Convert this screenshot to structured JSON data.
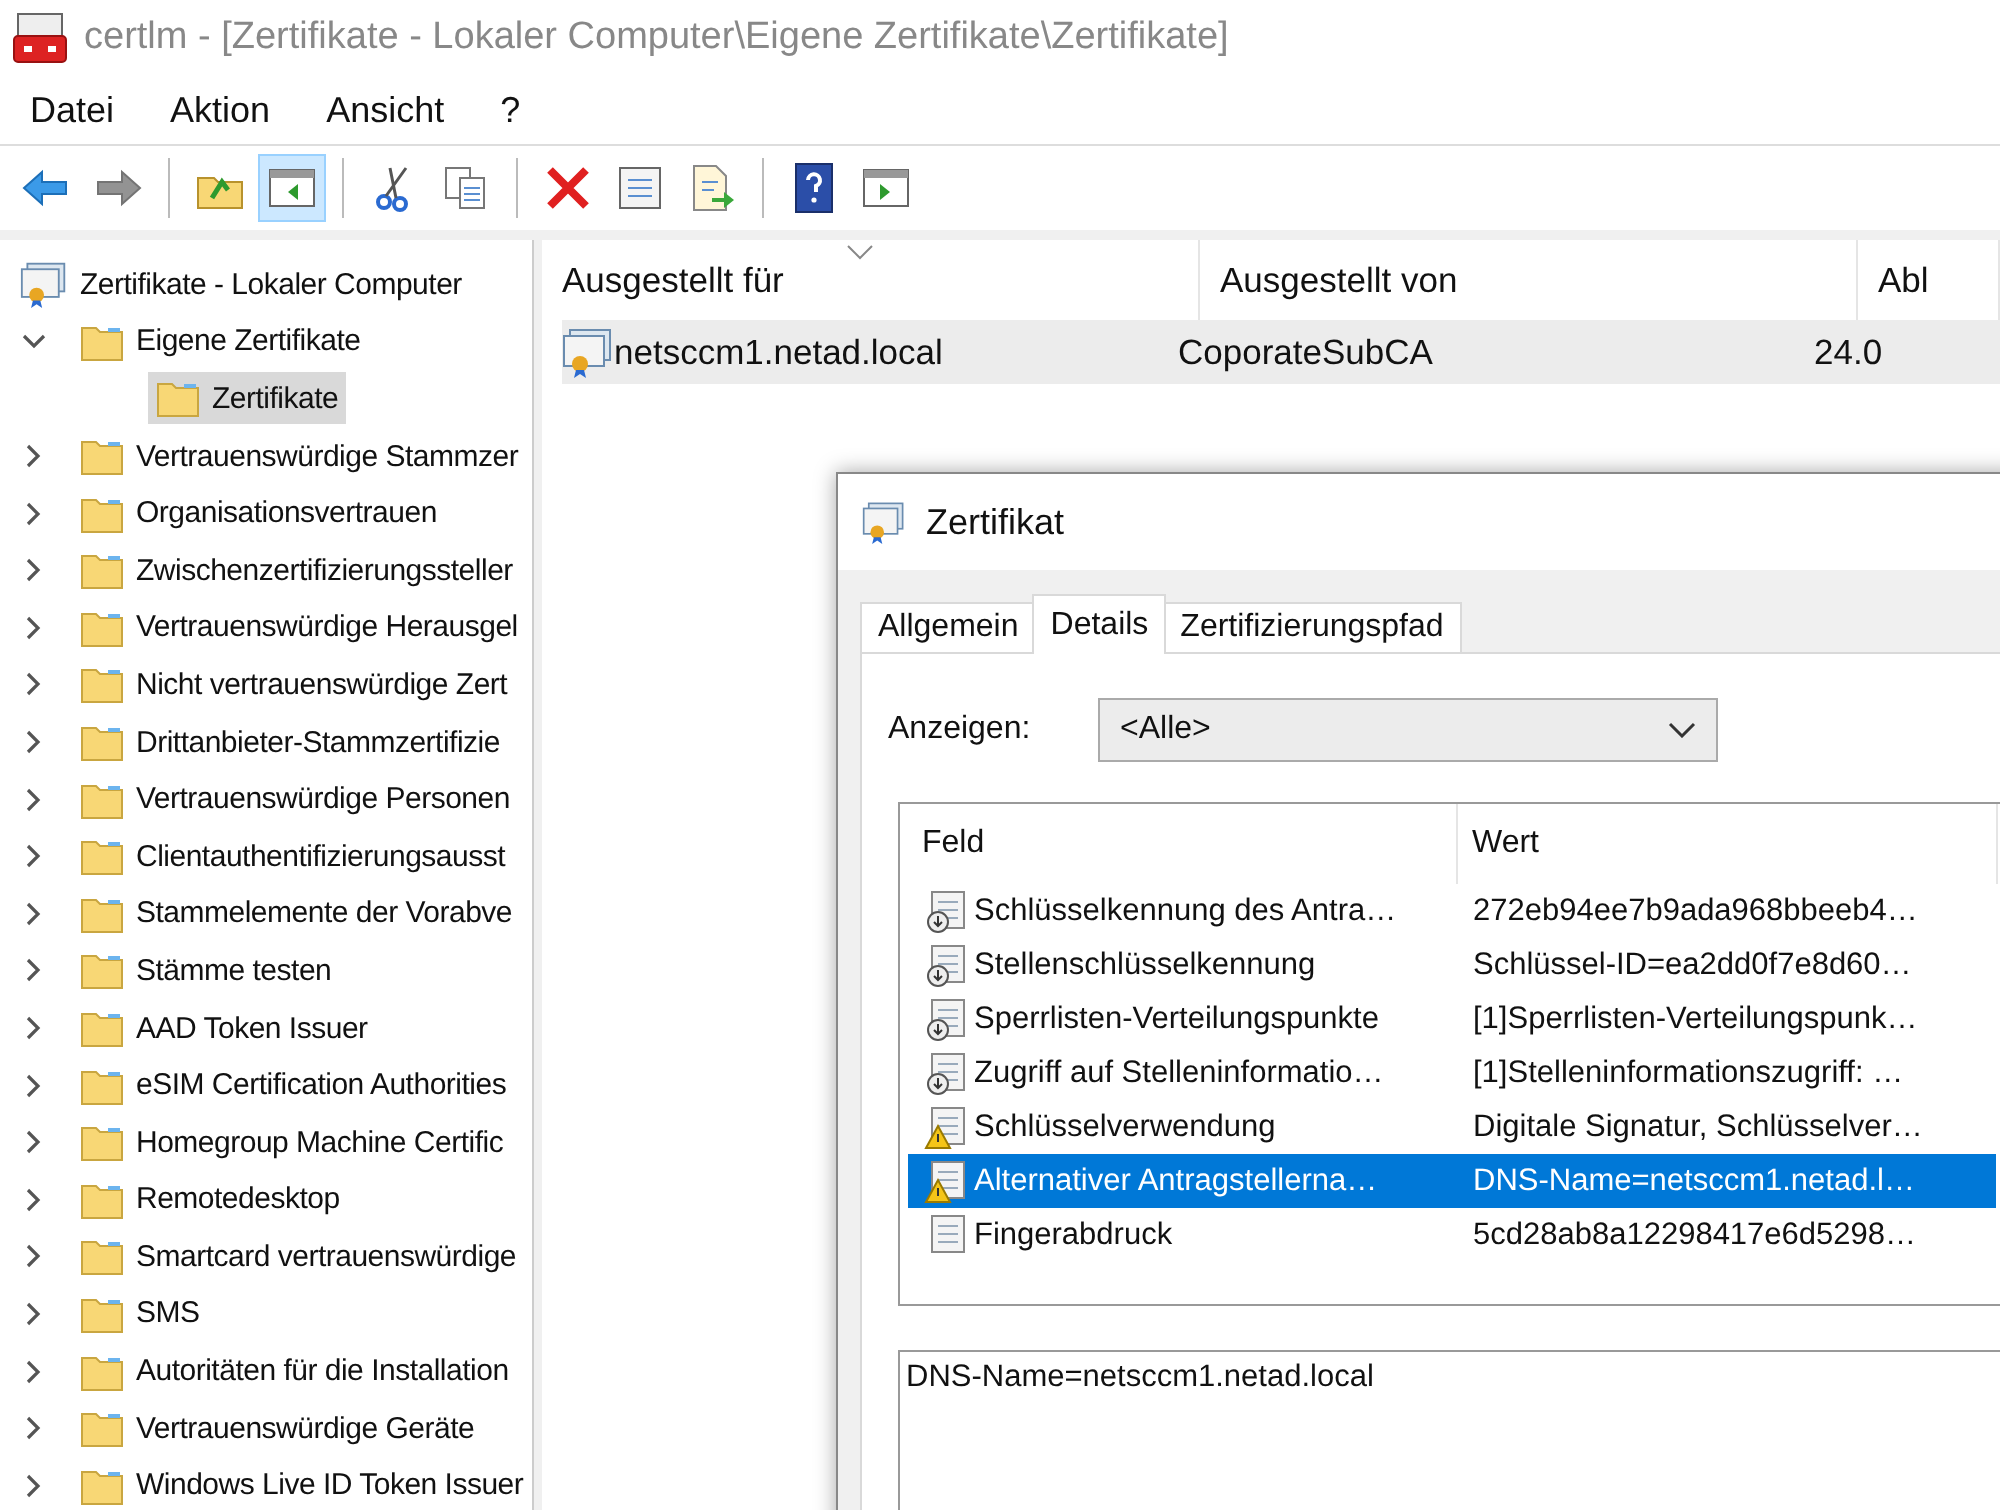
{
  "window": {
    "title": "certlm - [Zertifikate - Lokaler Computer\\Eigene Zertifikate\\Zertifikate]"
  },
  "menu": [
    "Datei",
    "Aktion",
    "Ansicht",
    "?"
  ],
  "toolbar": [
    [
      {
        "kind": "back",
        "disabled": false,
        "pressed": false
      },
      {
        "kind": "forward",
        "disabled": true,
        "pressed": false
      }
    ],
    [
      {
        "kind": "up-folder",
        "disabled": false,
        "pressed": false
      },
      {
        "kind": "console-tree",
        "disabled": false,
        "pressed": true
      }
    ],
    [
      {
        "kind": "cut",
        "disabled": false,
        "pressed": false
      },
      {
        "kind": "copy",
        "disabled": false,
        "pressed": false
      }
    ],
    [
      {
        "kind": "delete",
        "disabled": false,
        "pressed": false
      },
      {
        "kind": "properties",
        "disabled": false,
        "pressed": false
      },
      {
        "kind": "export",
        "disabled": false,
        "pressed": false
      }
    ],
    [
      {
        "kind": "help",
        "disabled": false,
        "pressed": false
      },
      {
        "kind": "action-pane",
        "disabled": false,
        "pressed": false
      }
    ]
  ],
  "tree": {
    "label": "Zertifikate - Lokaler Computer",
    "children": [
      {
        "label": "Eigene Zertifikate",
        "expanded": true,
        "selected": false,
        "children": [
          {
            "label": "Zertifikate",
            "selected": true
          }
        ]
      },
      {
        "label": "Vertrauenswürdige Stammzer",
        "expanded": false,
        "selected": false
      },
      {
        "label": "Organisationsvertrauen",
        "expanded": false,
        "selected": false
      },
      {
        "label": "Zwischenzertifizierungssteller",
        "expanded": false,
        "selected": false
      },
      {
        "label": "Vertrauenswürdige Herausgel",
        "expanded": false,
        "selected": false
      },
      {
        "label": "Nicht vertrauenswürdige Zert",
        "expanded": false,
        "selected": false
      },
      {
        "label": "Drittanbieter-Stammzertifizie",
        "expanded": false,
        "selected": false
      },
      {
        "label": "Vertrauenswürdige Personen",
        "expanded": false,
        "selected": false
      },
      {
        "label": "Clientauthentifizierungsausst",
        "expanded": false,
        "selected": false
      },
      {
        "label": "Stammelemente der Vorabve",
        "expanded": false,
        "selected": false
      },
      {
        "label": "Stämme testen",
        "expanded": false,
        "selected": false
      },
      {
        "label": "AAD Token Issuer",
        "expanded": false,
        "selected": false
      },
      {
        "label": "eSIM Certification Authorities",
        "expanded": false,
        "selected": false
      },
      {
        "label": "Homegroup Machine Certific",
        "expanded": false,
        "selected": false
      },
      {
        "label": "Remotedesktop",
        "expanded": false,
        "selected": false
      },
      {
        "label": "Smartcard vertrauenswürdige",
        "expanded": false,
        "selected": false
      },
      {
        "label": "SMS",
        "expanded": false,
        "selected": false
      },
      {
        "label": "Autoritäten für die Installation",
        "expanded": false,
        "selected": false
      },
      {
        "label": "Vertrauenswürdige Geräte",
        "expanded": false,
        "selected": false
      },
      {
        "label": "Windows Live ID Token Issuer",
        "expanded": false,
        "selected": false
      }
    ]
  },
  "list": {
    "columns": [
      "Ausgestellt für",
      "Ausgestellt von",
      "Abl"
    ],
    "rows": [
      {
        "cells": [
          "netsccm1.netad.local",
          "CoporateSubCA",
          "24.0"
        ],
        "selected": true
      }
    ]
  },
  "dialog": {
    "title": "Zertifikat",
    "tabs": [
      {
        "label": "Allgemein",
        "selected": false
      },
      {
        "label": "Details",
        "selected": true
      },
      {
        "label": "Zertifizierungspfad",
        "selected": false
      }
    ],
    "show_label": "Anzeigen:",
    "show_value": "<Alle>",
    "fields": {
      "columns": [
        "Feld",
        "Wert"
      ],
      "rows": [
        {
          "kind": "extension",
          "field": "Schlüsselkennung des Antra…",
          "value": "272eb94ee7b9ada968bbeeb4…",
          "selected": false
        },
        {
          "kind": "extension",
          "field": "Stellenschlüsselkennung",
          "value": "Schlüssel-ID=ea2dd0f7e8d60…",
          "selected": false
        },
        {
          "kind": "extension",
          "field": "Sperrlisten-Verteilungspunkte",
          "value": "[1]Sperrlisten-Verteilungspunk…",
          "selected": false
        },
        {
          "kind": "extension",
          "field": "Zugriff auf Stelleninformatio…",
          "value": "[1]Stelleninformationszugriff: …",
          "selected": false
        },
        {
          "kind": "critical",
          "field": "Schlüsselverwendung",
          "value": "Digitale Signatur, Schlüsselver…",
          "selected": false
        },
        {
          "kind": "critical",
          "field": "Alternativer Antragstellerna…",
          "value": "DNS-Name=netsccm1.netad.l…",
          "selected": true
        },
        {
          "kind": "property",
          "field": "Fingerabdruck",
          "value": "5cd28ab8a12298417e6d5298…",
          "selected": false
        }
      ]
    },
    "detail_value": "DNS-Name=netsccm1.netad.local"
  }
}
